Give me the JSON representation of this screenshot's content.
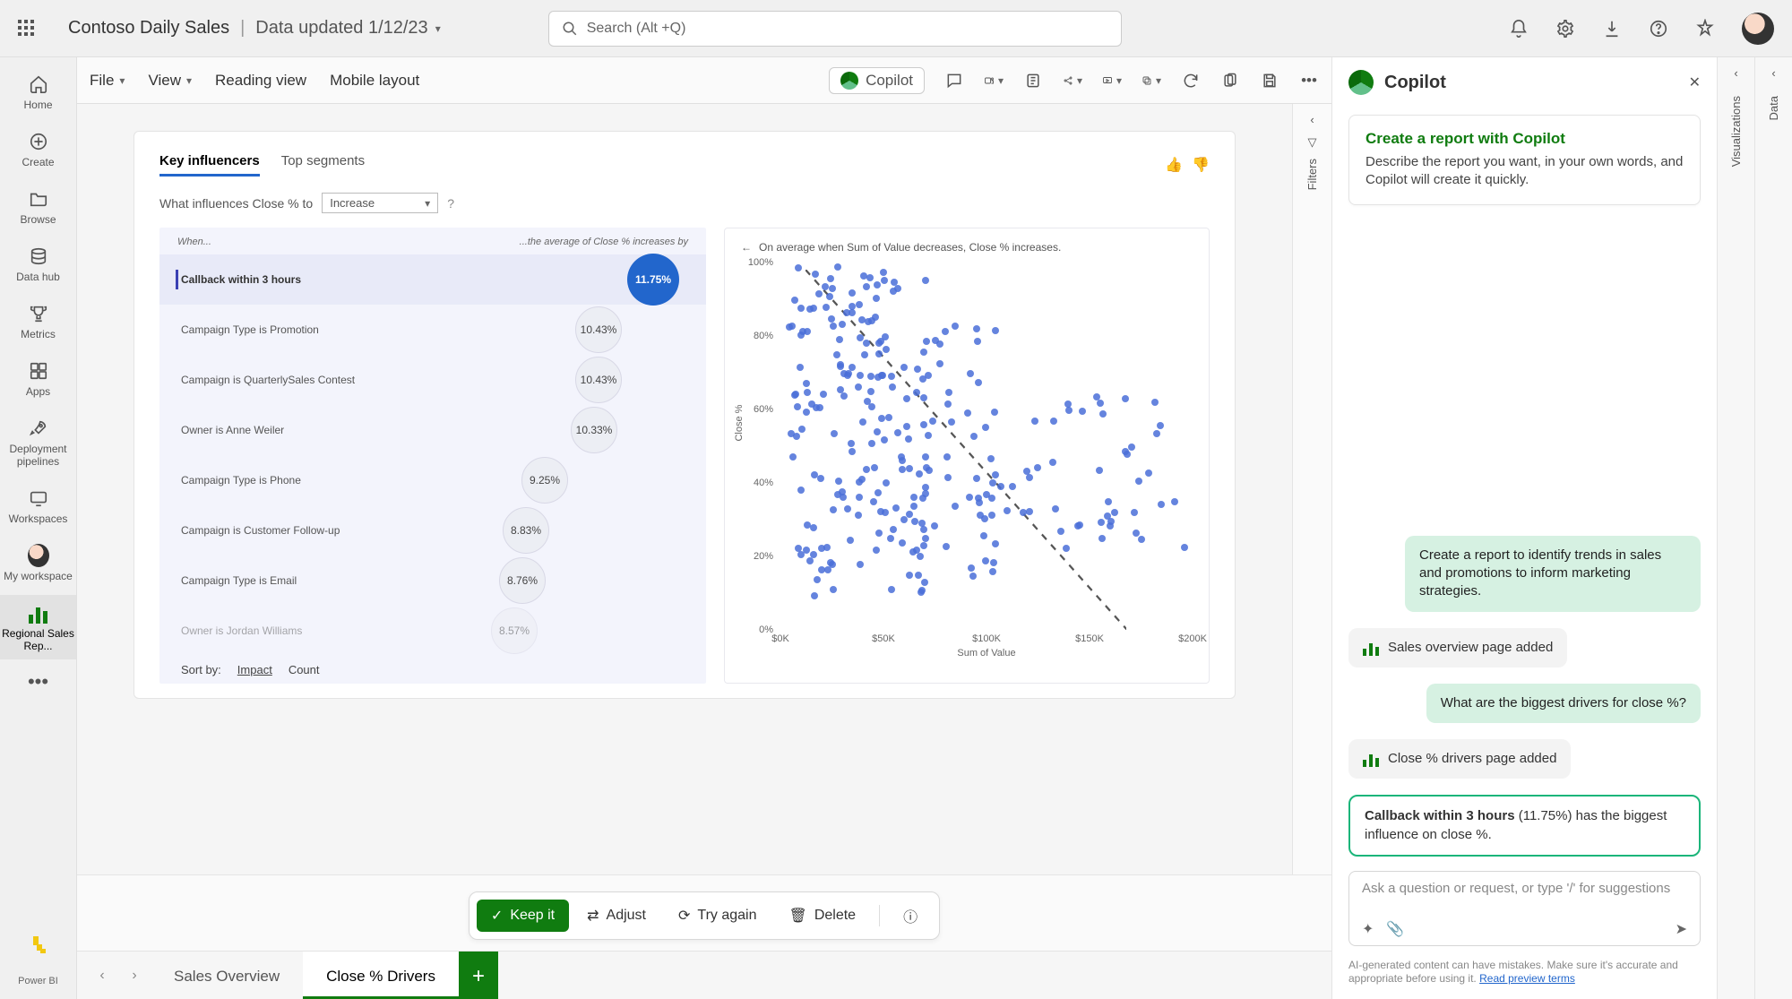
{
  "header": {
    "title": "Contoso Daily Sales",
    "subtitle": "Data updated 1/12/23",
    "search_placeholder": "Search (Alt +Q)"
  },
  "left_rail": {
    "items": [
      {
        "icon": "home-icon",
        "label": "Home"
      },
      {
        "icon": "plus-circle-icon",
        "label": "Create"
      },
      {
        "icon": "folder-icon",
        "label": "Browse"
      },
      {
        "icon": "data-hub-icon",
        "label": "Data hub"
      },
      {
        "icon": "trophy-icon",
        "label": "Metrics"
      },
      {
        "icon": "apps-icon",
        "label": "Apps"
      },
      {
        "icon": "rocket-icon",
        "label": "Deployment pipelines"
      },
      {
        "icon": "monitor-icon",
        "label": "Workspaces"
      },
      {
        "icon": "avatar-icon",
        "label": "My workspace"
      },
      {
        "icon": "bars-icon",
        "label": "Regional Sales Rep..."
      }
    ],
    "footer_label": "Power BI"
  },
  "ribbon": {
    "file": "File",
    "view": "View",
    "reading_view": "Reading view",
    "mobile_layout": "Mobile layout",
    "copilot": "Copilot"
  },
  "filters_label": "Filters",
  "report": {
    "tabs": {
      "key_influencers": "Key influencers",
      "top_segments": "Top segments"
    },
    "question_prefix": "What influences Close % to",
    "question_select": "Increase",
    "col_when": "When...",
    "col_avg": "...the average of Close % increases by",
    "sort_label": "Sort by:",
    "sort_impact": "Impact",
    "sort_count": "Count",
    "right_title": "On average when Sum of Value decreases, Close % increases."
  },
  "chart_data": {
    "influencers": {
      "type": "bar",
      "title": "Key influencers — average Close % increase",
      "xlabel": "",
      "ylabel": "average Close % increase",
      "categories": [
        "Callback within 3 hours",
        "Campaign Type is Promotion",
        "Campaign is QuarterlySales Contest",
        "Owner is Anne Weiler",
        "Campaign Type is Phone",
        "Campaign is Customer Follow-up",
        "Campaign Type is Email",
        "Owner is Jordan Williams"
      ],
      "values": [
        11.75,
        10.43,
        10.43,
        10.33,
        9.25,
        8.83,
        8.76,
        8.57
      ],
      "value_labels": [
        "11.75%",
        "10.43%",
        "10.43%",
        "10.33%",
        "9.25%",
        "8.83%",
        "8.76%",
        "8.57%"
      ],
      "selected_index": 0
    },
    "scatter": {
      "type": "scatter",
      "title": "On average when Sum of Value decreases, Close % increases.",
      "xlabel": "Sum of Value",
      "ylabel": "Close %",
      "x_ticks": [
        "$0K",
        "$50K",
        "$100K",
        "$150K",
        "$200K"
      ],
      "y_ticks": [
        "0%",
        "20%",
        "40%",
        "60%",
        "80%",
        "100%"
      ],
      "xlim": [
        0,
        200000
      ],
      "ylim": [
        0,
        100
      ],
      "trend": "negative",
      "series": [
        {
          "name": "points",
          "note": "~250 points, dense at low Sum of Value with Close % spanning 10–100; sparser past $120K with Close % mostly 20–60"
        }
      ]
    }
  },
  "actions": {
    "keep": "Keep it",
    "adjust": "Adjust",
    "try_again": "Try again",
    "delete": "Delete"
  },
  "page_tabs": {
    "sales_overview": "Sales Overview",
    "close_drivers": "Close % Drivers"
  },
  "copilot": {
    "title": "Copilot",
    "card_title": "Create a report with Copilot",
    "card_body": "Describe the report you want, in your own words, and Copilot will create it quickly.",
    "msg_user1": "Create a report to identify trends in sales and promotions to inform marketing strategies.",
    "msg_sys1": "Sales overview page added",
    "msg_user2": "What are the biggest drivers for close %?",
    "msg_sys2": "Close % drivers page added",
    "msg_highlight_bold": "Callback within 3 hours",
    "msg_highlight_paren": "(11.75%)",
    "msg_highlight_rest": " has the biggest influence on close %.",
    "input_placeholder": "Ask a question or request, or type '/' for suggestions",
    "disclaimer": "AI-generated content can have mistakes. Make sure it's accurate and appropriate before using it.",
    "disclaimer_link": "Read preview terms"
  },
  "right_panes": {
    "visualizations": "Visualizations",
    "data": "Data"
  }
}
